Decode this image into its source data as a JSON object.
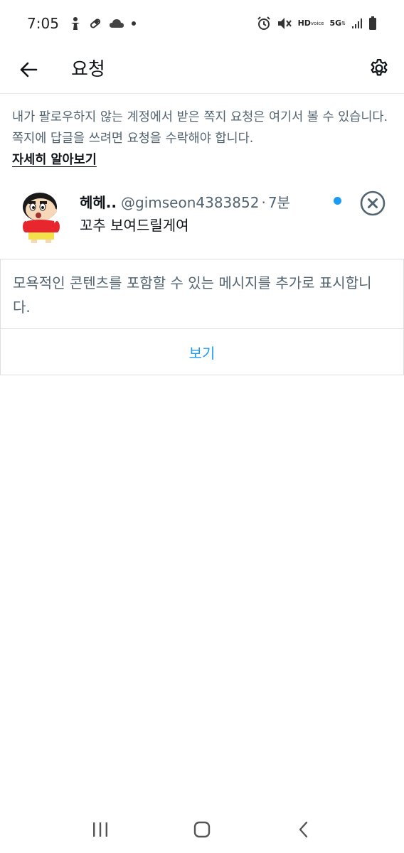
{
  "status_bar": {
    "time": "7:05",
    "hd_label": "HD",
    "voice_label": "voice",
    "network_label": "5G"
  },
  "header": {
    "title": "요청"
  },
  "info": {
    "description": "내가 팔로우하지 않는 계정에서 받은 쪽지 요청은 여기서 볼 수 있습니다. 쪽지에 답글을 쓰려면 요청을 수락해야 합니다.",
    "learn_more": "자세히 알아보기"
  },
  "request": {
    "name": "헤헤..",
    "handle": "@gimseon4383852",
    "separator": "·",
    "time": "7분",
    "message": "꼬추 보여드릴게여",
    "unread": true,
    "unread_color": "#1d9bf0"
  },
  "warning": {
    "text": "모욕적인 콘텐츠를 포함할 수 있는 메시지를 추가로 표시합니다.",
    "view_label": "보기"
  },
  "colors": {
    "accent": "#1d9bf0",
    "secondary_text": "#536471",
    "primary_text": "#0f1419"
  }
}
